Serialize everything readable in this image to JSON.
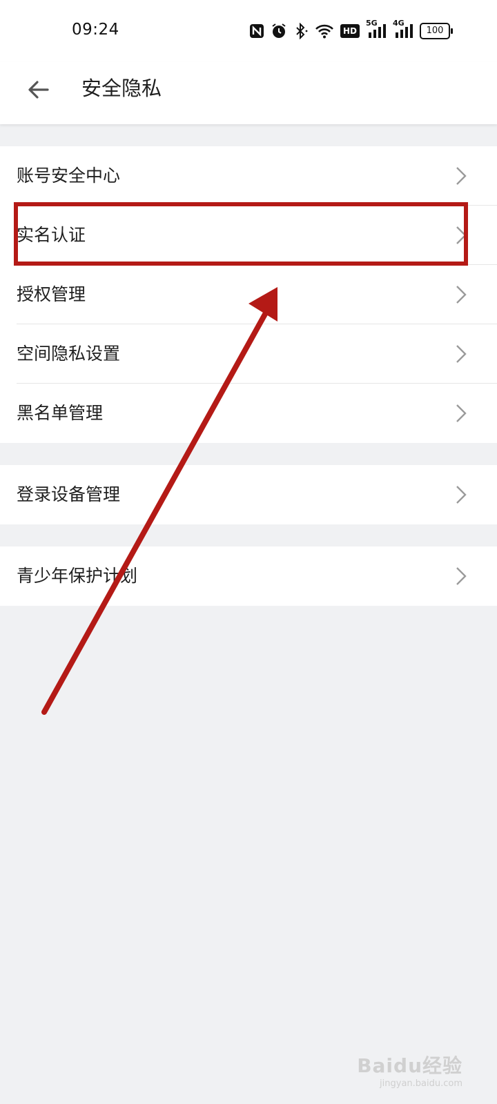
{
  "status_bar": {
    "time": "09:24",
    "icons": [
      "nfc-icon",
      "alarm-icon",
      "bluetooth-icon",
      "wifi-icon",
      "hd-voice-icon",
      "signal-5g-icon",
      "signal-4g-icon",
      "battery-icon"
    ],
    "hd_label": "HD",
    "net1": "5G",
    "net2": "4G",
    "battery": "100"
  },
  "appbar": {
    "title": "安全隐私",
    "back_icon": "back-arrow-icon"
  },
  "groups": [
    {
      "items": [
        "账号安全中心",
        "实名认证",
        "授权管理",
        "空间隐私设置",
        "黑名单管理"
      ]
    },
    {
      "items": [
        "登录设备管理"
      ]
    },
    {
      "items": [
        "青少年保护计划"
      ]
    }
  ],
  "annotation": {
    "color": "#b41a16",
    "highlighted_item": "实名认证"
  },
  "watermark": {
    "brand": "Baidu经验",
    "url": "jingyan.baidu.com"
  },
  "colors": {
    "background": "#f0f1f3",
    "surface": "#ffffff",
    "chevron": "#9a9a9a"
  }
}
